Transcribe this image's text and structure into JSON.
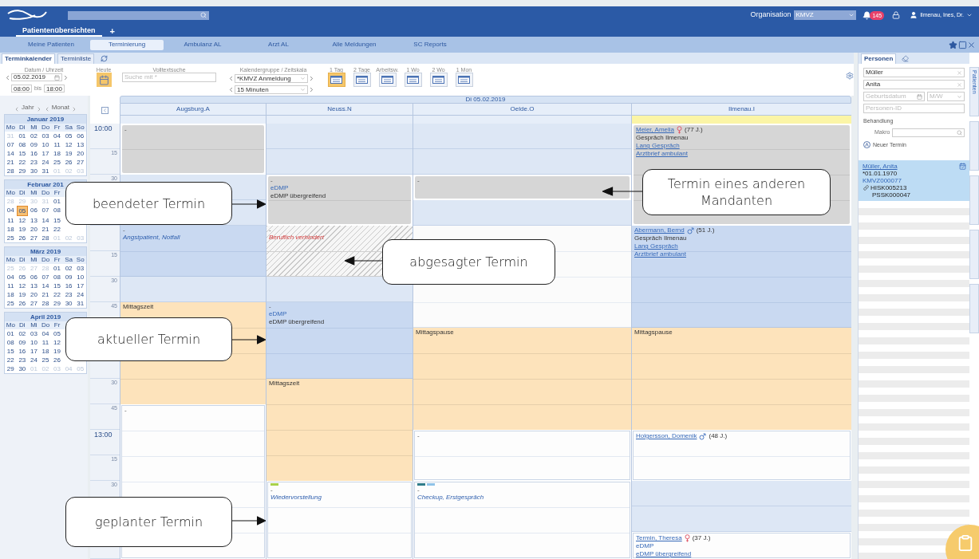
{
  "header": {
    "organisation_label": "Organisation",
    "organisation": "KMVZ",
    "notification_count": "145",
    "user": "Ilmenau, Ines, Dr."
  },
  "app_tabs": [
    {
      "label": "Patientenübersichten",
      "selected": true
    }
  ],
  "add_tab": "+",
  "nav": [
    {
      "label": "Meine Patienten",
      "selected": false
    },
    {
      "label": "Terminierung",
      "selected": true
    },
    {
      "label": "Ambulanz AL",
      "selected": false
    },
    {
      "label": "Arzt AL",
      "selected": false
    },
    {
      "label": "Alle Meldungen",
      "selected": false
    },
    {
      "label": "SC Reports",
      "selected": false
    }
  ],
  "view_tabs": [
    {
      "label": "Terminkalender",
      "selected": true
    },
    {
      "label": "Terminliste",
      "selected": false
    }
  ],
  "toolbar": {
    "date_label": "Datum / Uhrzeit",
    "date": "05.02.2019",
    "from": "08:00",
    "to_label": "bis",
    "to": "18:00",
    "today_label": "Heute",
    "search_label": "Volltextsuche",
    "search_placeholder": "Suche mit *",
    "group_label": "Kalendergruppe / Zeitskala",
    "group": "*KMVZ Anmeldung",
    "scale": "15 Minuten",
    "views": [
      {
        "label": "1 Tag",
        "selected": true
      },
      {
        "label": "2 Tage",
        "selected": false
      },
      {
        "label": "Arbeitsw.",
        "selected": false
      },
      {
        "label": "1 Wo",
        "selected": false
      },
      {
        "label": "2 Wo",
        "selected": false
      },
      {
        "label": "1 Mon",
        "selected": false
      }
    ]
  },
  "sidebar": {
    "year_label": "Jahr",
    "month_label": "Monat",
    "months": [
      {
        "title": "Januar 2019",
        "weekdays": [
          "Mo",
          "Di",
          "Mi",
          "Do",
          "Fr",
          "Sa",
          "So"
        ],
        "weeks": [
          [
            {
              "day": "31",
              "outside": true,
              "selected": false
            },
            {
              "day": "01",
              "outside": false,
              "selected": false
            },
            {
              "day": "02",
              "outside": false,
              "selected": false
            },
            {
              "day": "03",
              "outside": false,
              "selected": false
            },
            {
              "day": "04",
              "outside": false,
              "selected": false
            },
            {
              "day": "05",
              "outside": false,
              "selected": false
            },
            {
              "day": "06",
              "outside": false,
              "selected": false
            }
          ],
          [
            {
              "day": "07",
              "outside": false,
              "selected": false
            },
            {
              "day": "08",
              "outside": false,
              "selected": false
            },
            {
              "day": "09",
              "outside": false,
              "selected": false
            },
            {
              "day": "10",
              "outside": false,
              "selected": false
            },
            {
              "day": "11",
              "outside": false,
              "selected": false
            },
            {
              "day": "12",
              "outside": false,
              "selected": false
            },
            {
              "day": "13",
              "outside": false,
              "selected": false
            }
          ],
          [
            {
              "day": "14",
              "outside": false,
              "selected": false
            },
            {
              "day": "15",
              "outside": false,
              "selected": false
            },
            {
              "day": "16",
              "outside": false,
              "selected": false
            },
            {
              "day": "17",
              "outside": false,
              "selected": false
            },
            {
              "day": "18",
              "outside": false,
              "selected": false
            },
            {
              "day": "19",
              "outside": false,
              "selected": false
            },
            {
              "day": "20",
              "outside": false,
              "selected": false
            }
          ],
          [
            {
              "day": "21",
              "outside": false,
              "selected": false
            },
            {
              "day": "22",
              "outside": false,
              "selected": false
            },
            {
              "day": "23",
              "outside": false,
              "selected": false
            },
            {
              "day": "24",
              "outside": false,
              "selected": false
            },
            {
              "day": "25",
              "outside": false,
              "selected": false
            },
            {
              "day": "26",
              "outside": false,
              "selected": false
            },
            {
              "day": "27",
              "outside": false,
              "selected": false
            }
          ],
          [
            {
              "day": "28",
              "outside": false,
              "selected": false
            },
            {
              "day": "29",
              "outside": false,
              "selected": false
            },
            {
              "day": "30",
              "outside": false,
              "selected": false
            },
            {
              "day": "31",
              "outside": false,
              "selected": false
            },
            {
              "day": "01",
              "outside": true,
              "selected": false
            },
            {
              "day": "02",
              "outside": true,
              "selected": false
            },
            {
              "day": "03",
              "outside": true,
              "selected": false
            }
          ]
        ]
      },
      {
        "title": "Februar 201",
        "weekdays": [
          "Mo",
          "Di",
          "Mi",
          "Do",
          "Fr"
        ],
        "weeks": [
          [
            {
              "day": "28",
              "outside": true,
              "selected": false
            },
            {
              "day": "29",
              "outside": true,
              "selected": false
            },
            {
              "day": "30",
              "outside": true,
              "selected": false
            },
            {
              "day": "31",
              "outside": true,
              "selected": false
            },
            {
              "day": "01",
              "outside": false,
              "selected": false
            }
          ],
          [
            {
              "day": "04",
              "outside": false,
              "selected": false
            },
            {
              "day": "05",
              "outside": false,
              "selected": true
            },
            {
              "day": "06",
              "outside": false,
              "selected": false
            },
            {
              "day": "07",
              "outside": false,
              "selected": false
            },
            {
              "day": "08",
              "outside": false,
              "selected": false
            }
          ],
          [
            {
              "day": "11",
              "outside": false,
              "selected": false
            },
            {
              "day": "12",
              "outside": false,
              "selected": false
            },
            {
              "day": "13",
              "outside": false,
              "selected": false
            },
            {
              "day": "14",
              "outside": false,
              "selected": false
            },
            {
              "day": "15",
              "outside": false,
              "selected": false
            }
          ],
          [
            {
              "day": "18",
              "outside": false,
              "selected": false
            },
            {
              "day": "19",
              "outside": false,
              "selected": false
            },
            {
              "day": "20",
              "outside": false,
              "selected": false
            },
            {
              "day": "21",
              "outside": false,
              "selected": false
            },
            {
              "day": "22",
              "outside": false,
              "selected": false
            }
          ],
          [
            {
              "day": "25",
              "outside": false,
              "selected": false
            },
            {
              "day": "26",
              "outside": false,
              "selected": false
            },
            {
              "day": "27",
              "outside": false,
              "selected": false
            },
            {
              "day": "28",
              "outside": false,
              "selected": false
            },
            {
              "day": "01",
              "outside": true,
              "selected": false
            },
            {
              "day": "02",
              "outside": true,
              "selected": false
            },
            {
              "day": "03",
              "outside": true,
              "selected": false
            }
          ]
        ]
      },
      {
        "title": "März 2019",
        "weekdays": [
          "Mo",
          "Di",
          "Mi",
          "Do",
          "Fr",
          "Sa",
          "So"
        ],
        "weeks": [
          [
            {
              "day": "25",
              "outside": true,
              "selected": false
            },
            {
              "day": "26",
              "outside": true,
              "selected": false
            },
            {
              "day": "27",
              "outside": true,
              "selected": false
            },
            {
              "day": "28",
              "outside": true,
              "selected": false
            },
            {
              "day": "01",
              "outside": false,
              "selected": false
            },
            {
              "day": "02",
              "outside": false,
              "selected": false
            },
            {
              "day": "03",
              "outside": false,
              "selected": false
            }
          ],
          [
            {
              "day": "04",
              "outside": false,
              "selected": false
            },
            {
              "day": "05",
              "outside": false,
              "selected": false
            },
            {
              "day": "06",
              "outside": false,
              "selected": false
            },
            {
              "day": "07",
              "outside": false,
              "selected": false
            },
            {
              "day": "08",
              "outside": false,
              "selected": false
            },
            {
              "day": "09",
              "outside": false,
              "selected": false
            },
            {
              "day": "10",
              "outside": false,
              "selected": false
            }
          ],
          [
            {
              "day": "11",
              "outside": false,
              "selected": false
            },
            {
              "day": "12",
              "outside": false,
              "selected": false
            },
            {
              "day": "13",
              "outside": false,
              "selected": false
            },
            {
              "day": "14",
              "outside": false,
              "selected": false
            },
            {
              "day": "15",
              "outside": false,
              "selected": false
            },
            {
              "day": "16",
              "outside": false,
              "selected": false
            },
            {
              "day": "17",
              "outside": false,
              "selected": false
            }
          ],
          [
            {
              "day": "18",
              "outside": false,
              "selected": false
            },
            {
              "day": "19",
              "outside": false,
              "selected": false
            },
            {
              "day": "20",
              "outside": false,
              "selected": false
            },
            {
              "day": "21",
              "outside": false,
              "selected": false
            },
            {
              "day": "22",
              "outside": false,
              "selected": false
            },
            {
              "day": "23",
              "outside": false,
              "selected": false
            },
            {
              "day": "24",
              "outside": false,
              "selected": false
            }
          ],
          [
            {
              "day": "25",
              "outside": false,
              "selected": false
            },
            {
              "day": "26",
              "outside": false,
              "selected": false
            },
            {
              "day": "27",
              "outside": false,
              "selected": false
            },
            {
              "day": "28",
              "outside": false,
              "selected": false
            },
            {
              "day": "29",
              "outside": false,
              "selected": false
            },
            {
              "day": "30",
              "outside": false,
              "selected": false
            },
            {
              "day": "31",
              "outside": false,
              "selected": false
            }
          ]
        ]
      },
      {
        "title": "April 2019",
        "weekdays": [
          "Mo",
          "Di",
          "Mi",
          "Do",
          "Fr"
        ],
        "weeks": [
          [
            {
              "day": "01",
              "outside": false,
              "selected": false
            },
            {
              "day": "02",
              "outside": false,
              "selected": false
            },
            {
              "day": "03",
              "outside": false,
              "selected": false
            },
            {
              "day": "04",
              "outside": false,
              "selected": false
            },
            {
              "day": "05",
              "outside": false,
              "selected": false
            }
          ],
          [
            {
              "day": "08",
              "outside": false,
              "selected": false
            },
            {
              "day": "09",
              "outside": false,
              "selected": false
            },
            {
              "day": "10",
              "outside": false,
              "selected": false
            },
            {
              "day": "11",
              "outside": false,
              "selected": false
            },
            {
              "day": "12",
              "outside": false,
              "selected": false
            }
          ],
          [
            {
              "day": "15",
              "outside": false,
              "selected": false
            },
            {
              "day": "16",
              "outside": false,
              "selected": false
            },
            {
              "day": "17",
              "outside": false,
              "selected": false
            },
            {
              "day": "18",
              "outside": false,
              "selected": false
            },
            {
              "day": "19",
              "outside": false,
              "selected": false
            }
          ],
          [
            {
              "day": "22",
              "outside": false,
              "selected": false
            },
            {
              "day": "23",
              "outside": false,
              "selected": false
            },
            {
              "day": "24",
              "outside": false,
              "selected": false
            },
            {
              "day": "25",
              "outside": false,
              "selected": false
            },
            {
              "day": "26",
              "outside": false,
              "selected": false
            }
          ],
          [
            {
              "day": "29",
              "outside": false,
              "selected": false
            },
            {
              "day": "30",
              "outside": false,
              "selected": false
            },
            {
              "day": "01",
              "outside": true,
              "selected": false
            },
            {
              "day": "02",
              "outside": true,
              "selected": false
            },
            {
              "day": "03",
              "outside": true,
              "selected": false
            },
            {
              "day": "04",
              "outside": true,
              "selected": false
            },
            {
              "day": "05",
              "outside": true,
              "selected": false
            }
          ]
        ]
      }
    ]
  },
  "calendar": {
    "date": "Di 05.02.2019",
    "time_labels": [
      {
        "label": "10:00",
        "hour": true
      },
      {
        "label": "15",
        "hour": false
      },
      {
        "label": "30",
        "hour": false
      },
      {
        "label": "15",
        "hour": false
      },
      {
        "label": "30",
        "hour": false
      },
      {
        "label": "45",
        "hour": false
      },
      {
        "label": "30",
        "hour": false
      },
      {
        "label": "45",
        "hour": false
      },
      {
        "label": "13:00",
        "hour": true
      },
      {
        "label": "15",
        "hour": false
      },
      {
        "label": "30",
        "hour": false
      }
    ],
    "columns": [
      {
        "name": "Augsburg.A",
        "highlighted": false,
        "slots": [
          {
            "kind": "ended",
            "continues": false,
            "lines": [
              {
                "kind": "dash",
                "text": "-"
              }
            ]
          },
          {
            "kind": "ended",
            "continues": true
          },
          {
            "kind": "free",
            "continues": false
          },
          {
            "kind": "free",
            "continues": false
          },
          {
            "kind": "current",
            "continues": false,
            "lines": [
              {
                "kind": "dash",
                "text": "-"
              },
              {
                "kind": "title",
                "text": "Angstpatient, Notfall"
              }
            ]
          },
          {
            "kind": "current",
            "continues": true
          },
          {
            "kind": "free",
            "continues": false
          },
          {
            "kind": "break",
            "continues": false,
            "lines": [
              {
                "kind": "text",
                "text": "Mittagszeit"
              }
            ]
          },
          {
            "kind": "break",
            "continues": true
          },
          {
            "kind": "break",
            "continues": true
          },
          {
            "kind": "break",
            "continues": true
          },
          {
            "kind": "planned",
            "continues": false,
            "lines": [
              {
                "kind": "dash",
                "text": "-"
              }
            ]
          },
          {
            "kind": "planned",
            "continues": true
          },
          {
            "kind": "planned",
            "continues": true
          },
          {
            "kind": "planned",
            "continues": true
          },
          {
            "kind": "planned",
            "continues": true
          },
          {
            "kind": "planned",
            "continues": true
          }
        ]
      },
      {
        "name": "Neuss.N",
        "highlighted": false,
        "slots": [
          {
            "kind": "free",
            "continues": false
          },
          {
            "kind": "free",
            "continues": false
          },
          {
            "kind": "ended",
            "continues": false,
            "lines": [
              {
                "kind": "dash",
                "text": "-"
              },
              {
                "kind": "type",
                "text": "eDMP"
              },
              {
                "kind": "text",
                "text": "eDMP übergreifend"
              }
            ]
          },
          {
            "kind": "ended",
            "continues": true
          },
          {
            "kind": "cancelled",
            "continues": false,
            "lines": [
              {
                "kind": "dash",
                "text": "-"
              },
              {
                "kind": "cancel",
                "text": "Beruflich verhindert"
              }
            ]
          },
          {
            "kind": "cancelled",
            "continues": true
          },
          {
            "kind": "free",
            "continues": false
          },
          {
            "kind": "current",
            "continues": false,
            "lines": [
              {
                "kind": "dash",
                "text": "-"
              },
              {
                "kind": "type",
                "text": "eDMP"
              },
              {
                "kind": "text",
                "text": "eDMP übergreifend"
              }
            ]
          },
          {
            "kind": "current",
            "continues": true
          },
          {
            "kind": "current",
            "continues": true
          },
          {
            "kind": "break",
            "continues": false,
            "lines": [
              {
                "kind": "text",
                "text": "Mittagszeit"
              }
            ]
          },
          {
            "kind": "break",
            "continues": true
          },
          {
            "kind": "break",
            "continues": true
          },
          {
            "kind": "break",
            "continues": true
          },
          {
            "kind": "planned",
            "continues": false,
            "markers": [
              {
                "color": "#a9d14b"
              }
            ],
            "lines": [
              {
                "kind": "dash",
                "text": "-"
              },
              {
                "kind": "title",
                "text": "Wiedervorstellung"
              }
            ]
          },
          {
            "kind": "planned",
            "continues": true
          },
          {
            "kind": "planned",
            "continues": true
          }
        ]
      },
      {
        "name": "Oelde.O",
        "highlighted": false,
        "slots": [
          {
            "kind": "free",
            "continues": false
          },
          {
            "kind": "free",
            "continues": false
          },
          {
            "kind": "foreign",
            "continues": false,
            "lines": [
              {
                "kind": "dash",
                "text": "-"
              }
            ]
          },
          {
            "kind": "free",
            "continues": false
          },
          {
            "kind": "blank",
            "continues": false
          },
          {
            "kind": "blank",
            "continues": true
          },
          {
            "kind": "blank",
            "continues": true
          },
          {
            "kind": "blank",
            "continues": true
          },
          {
            "kind": "break",
            "continues": false,
            "lines": [
              {
                "kind": "text",
                "text": "Mittagspause"
              }
            ]
          },
          {
            "kind": "break",
            "continues": true
          },
          {
            "kind": "break",
            "continues": true
          },
          {
            "kind": "break",
            "continues": true
          },
          {
            "kind": "planned",
            "continues": false,
            "lines": [
              {
                "kind": "dash",
                "text": "-"
              }
            ]
          },
          {
            "kind": "planned",
            "continues": true
          },
          {
            "kind": "planned",
            "continues": false,
            "markers": [
              {
                "color": "#2f7c8a"
              },
              {
                "color": "#8fc3e8"
              }
            ],
            "lines": [
              {
                "kind": "dash",
                "text": "-"
              },
              {
                "kind": "title",
                "text": "Checkup, Erstgespräch"
              }
            ]
          },
          {
            "kind": "planned",
            "continues": true
          },
          {
            "kind": "planned",
            "continues": true
          }
        ]
      },
      {
        "name": "Ilmenau.I",
        "highlighted": true,
        "slots": [
          {
            "kind": "ended",
            "continues": false,
            "lines": [
              {
                "kind": "patient",
                "name": "Meier, Amelia",
                "female": true,
                "age": "(77 J.)"
              },
              {
                "kind": "text",
                "text": "Gespräch Ilmenau"
              },
              {
                "kind": "link",
                "text": "Lang Gespräch"
              },
              {
                "kind": "link",
                "text": "Arztbrief ambulant"
              }
            ]
          },
          {
            "kind": "ended",
            "continues": true
          },
          {
            "kind": "ended",
            "continues": true
          },
          {
            "kind": "ended",
            "continues": true
          },
          {
            "kind": "current",
            "continues": false,
            "lines": [
              {
                "kind": "patient",
                "name": "Abermann, Bernd",
                "female": false,
                "age": "(51 J.)"
              },
              {
                "kind": "text",
                "text": "Gespräch Ilmenau"
              },
              {
                "kind": "link",
                "text": "Lang Gespräch"
              },
              {
                "kind": "link",
                "text": "Arztbrief ambulant"
              }
            ]
          },
          {
            "kind": "current",
            "continues": true
          },
          {
            "kind": "current",
            "continues": true
          },
          {
            "kind": "current",
            "continues": true
          },
          {
            "kind": "break",
            "continues": false,
            "lines": [
              {
                "kind": "text",
                "text": "Mittagspause"
              }
            ]
          },
          {
            "kind": "break",
            "continues": true
          },
          {
            "kind": "break",
            "continues": true
          },
          {
            "kind": "break",
            "continues": true
          },
          {
            "kind": "planned",
            "continues": false,
            "lines": [
              {
                "kind": "patient",
                "name": "Holgersson, Domenik",
                "female": false,
                "age": "(48 J.)"
              }
            ]
          },
          {
            "kind": "planned",
            "continues": true
          },
          {
            "kind": "free",
            "continues": false
          },
          {
            "kind": "free",
            "continues": false
          },
          {
            "kind": "planned",
            "continues": false,
            "lines": [
              {
                "kind": "patient",
                "name": "Termin, Theresa",
                "female": true,
                "age": "(37 J.)"
              },
              {
                "kind": "type",
                "text": "eDMP"
              },
              {
                "kind": "link",
                "text": "eDMP übergreifend"
              }
            ]
          }
        ]
      }
    ]
  },
  "callouts": [
    {
      "text": "beendeter Termin",
      "points_left": false
    },
    {
      "text": "Termin eines anderen Mandanten",
      "points_left": true
    },
    {
      "text": "abgesagter Termin",
      "points_left": true
    },
    {
      "text": "aktueller Termin",
      "points_left": false
    },
    {
      "text": "geplanter Termin",
      "points_left": false
    }
  ],
  "right_panel": {
    "tabs": [
      {
        "label": "Personen",
        "selected": true
      }
    ],
    "last_name": "Müller",
    "first_name": "Anita",
    "birthdate_placeholder": "Geburtsdatum",
    "gender_placeholder": "M/W",
    "id_placeholder": "Personen-ID",
    "treatment_label": "Behandlung",
    "macro_label": "Makro",
    "new_appointment": "Neuer Termin",
    "patient": {
      "name": "Müller, Anita",
      "birthdate": "*01.01.1970",
      "number": "KMVZ000077",
      "ids": [
        "HISK005213",
        "PSSK000047"
      ]
    },
    "side_tabs": [
      {
        "label": "Patienten"
      }
    ]
  }
}
